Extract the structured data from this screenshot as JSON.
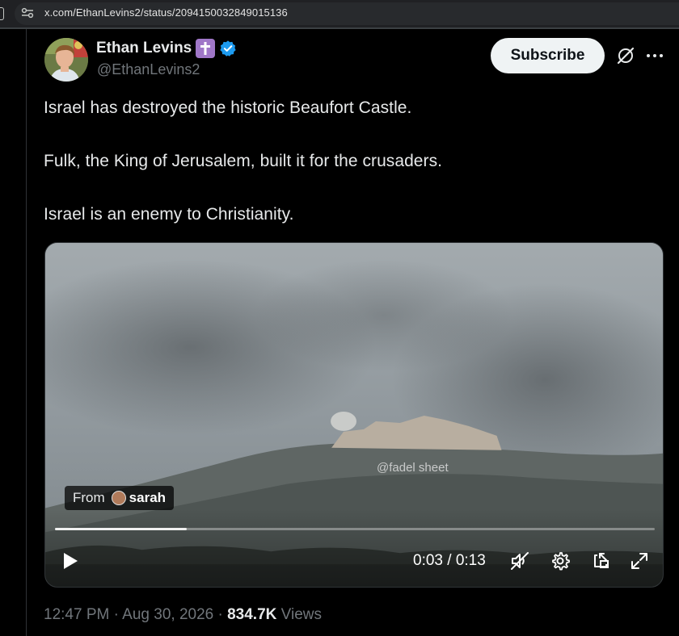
{
  "browser": {
    "url": "x.com/EthanLevins2/status/2094150032849015136"
  },
  "tweet": {
    "author": {
      "name": "Ethan Levins",
      "handle": "@EthanLevins2",
      "name_badge_icon": "latin-cross-icon",
      "verified_icon": "verified-badge-icon",
      "badge_color": "#a077c8",
      "verified_color": "#1d9bf0"
    },
    "subscribe_label": "Subscribe",
    "text_lines": [
      "Israel has destroyed the historic Beaufort Castle.",
      "Fulk, the King of Jerusalem, built it for the crusaders.",
      "Israel is an enemy to Christianity."
    ],
    "video": {
      "watermark": "@fadel sheet",
      "from_label": "From",
      "from_name": "sarah",
      "current_time": "0:03",
      "duration": "0:13",
      "time_display": "0:03 / 0:13",
      "progress_fraction": 0.22
    },
    "meta": {
      "time": "12:47 PM",
      "separator": "·",
      "date": "Aug 30, 2026",
      "views_count": "834.7K",
      "views_label": "Views"
    }
  }
}
